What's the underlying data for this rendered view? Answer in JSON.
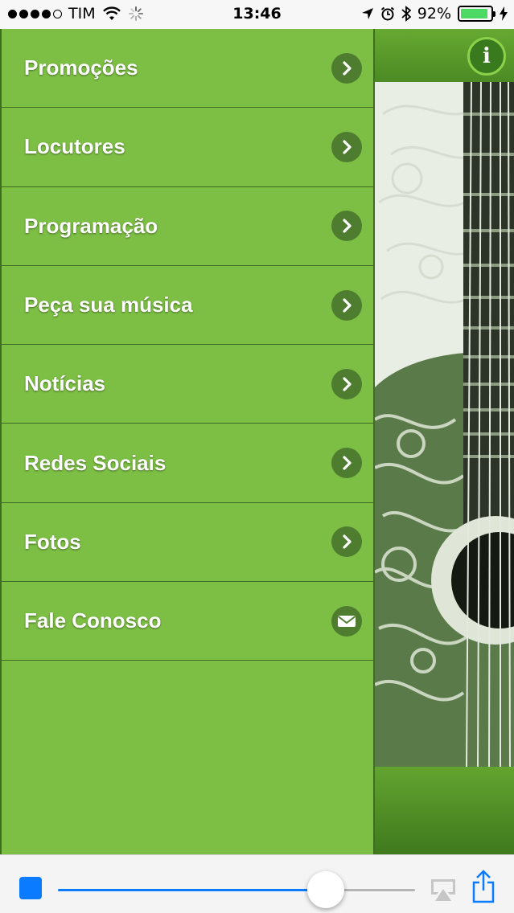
{
  "status_bar": {
    "carrier": "TIM",
    "time": "13:46",
    "battery_percent": "92%",
    "battery_level": 0.92,
    "signal_dots_filled": 4,
    "signal_dots_total": 5,
    "icons": [
      "wifi-icon",
      "loading-spinner-icon",
      "location-arrow-icon",
      "alarm-icon",
      "bluetooth-icon",
      "charging-bolt-icon"
    ]
  },
  "header": {
    "info_icon": "info-icon"
  },
  "menu": {
    "items": [
      {
        "label": "Promoções",
        "icon": "chevron-right-icon"
      },
      {
        "label": "Locutores",
        "icon": "chevron-right-icon"
      },
      {
        "label": "Programação",
        "icon": "chevron-right-icon"
      },
      {
        "label": "Peça sua música",
        "icon": "chevron-right-icon"
      },
      {
        "label": "Notícias",
        "icon": "chevron-right-icon"
      },
      {
        "label": "Redes Sociais",
        "icon": "chevron-right-icon"
      },
      {
        "label": "Fotos",
        "icon": "chevron-right-icon"
      },
      {
        "label": "Fale Conosco",
        "icon": "envelope-icon"
      }
    ]
  },
  "player": {
    "progress": 0.75,
    "icons": [
      "stop-icon",
      "airplay-icon",
      "share-icon"
    ]
  },
  "colors": {
    "menu_green": "#7dbf44",
    "icon_circle": "#4e7d2f",
    "accent_blue": "#0a7aff"
  }
}
